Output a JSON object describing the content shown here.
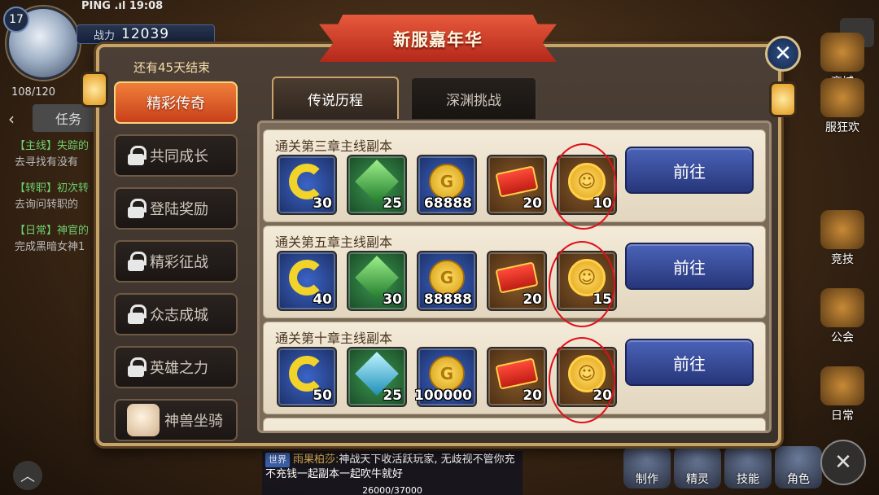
{
  "hud": {
    "level": "17",
    "ping": "PING .ıl 19:08",
    "power_label": "战力",
    "power_value": "12039",
    "stamina": "108/120",
    "task_tab": "任务",
    "quests": [
      {
        "title": "【主线】失踪的",
        "desc": "去寻找有没有"
      },
      {
        "title": "【转职】初次转",
        "desc": "去询问转职的"
      },
      {
        "title": "【日常】神官的",
        "desc": "完成黑暗女神1"
      }
    ],
    "side_icons": [
      "商城",
      "服狂欢",
      "竞技",
      "公会",
      "日常"
    ],
    "chat": {
      "channel": "世界",
      "sender": "雨果柏莎:",
      "message": "神战天下收活跃玩家, 无歧视不管你充不充钱一起副本一起吹牛就好"
    },
    "exp": "26000/37000",
    "bottom_buttons": [
      "制作",
      "精灵",
      "技能",
      "角色"
    ]
  },
  "panel": {
    "title": "新服嘉年华",
    "countdown": "还有45天结束",
    "menu": [
      {
        "label": "精彩传奇",
        "locked": false,
        "active": true
      },
      {
        "label": "共同成长",
        "locked": true
      },
      {
        "label": "登陆奖励",
        "locked": true
      },
      {
        "label": "精彩征战",
        "locked": true
      },
      {
        "label": "众志成城",
        "locked": true
      },
      {
        "label": "英雄之力",
        "locked": true
      },
      {
        "label": "神兽坐骑",
        "locked": false
      }
    ],
    "tabs": [
      "传说历程",
      "深渊挑战"
    ],
    "goto_label": "前往",
    "rows": [
      {
        "title": "通关第三章主线副本",
        "rewards": [
          "30",
          "25",
          "68888",
          "20",
          "10"
        ]
      },
      {
        "title": "通关第五章主线副本",
        "rewards": [
          "40",
          "30",
          "88888",
          "20",
          "15"
        ]
      },
      {
        "title": "通关第十章主线副本",
        "rewards": [
          "50",
          "25",
          "100000",
          "20",
          "20"
        ]
      }
    ]
  }
}
